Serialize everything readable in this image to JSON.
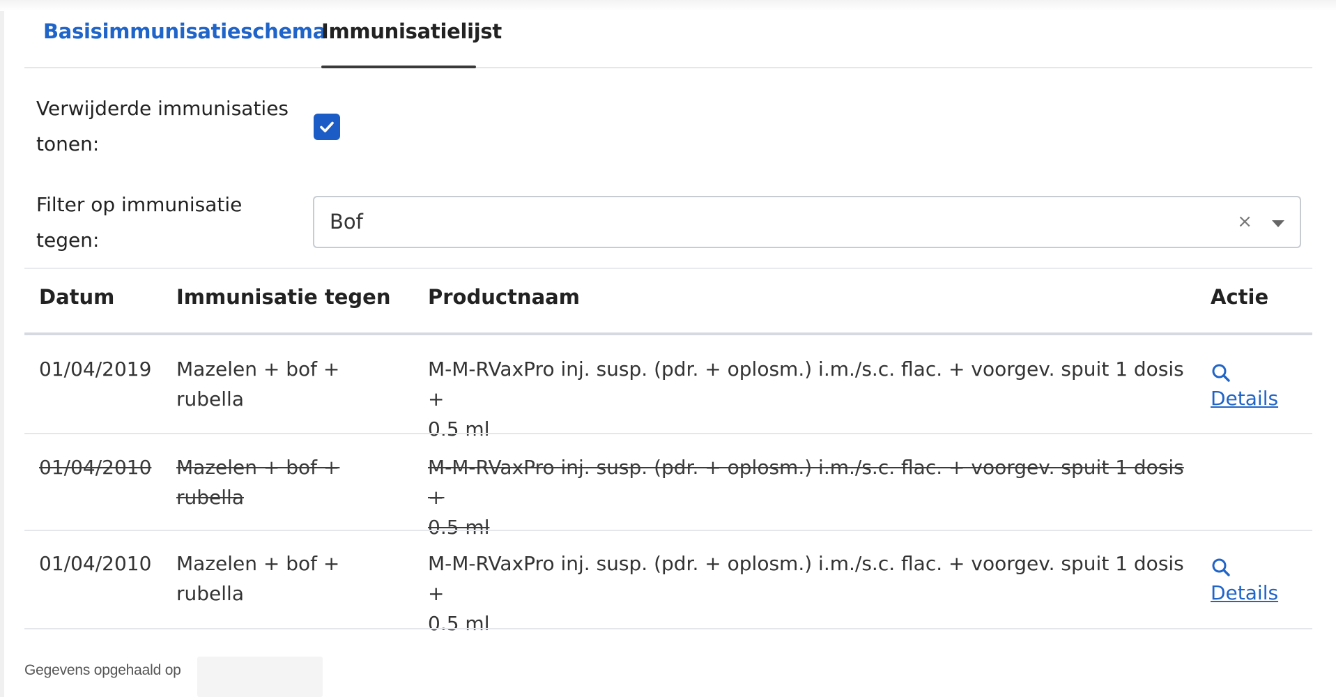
{
  "tabs": [
    {
      "label": "Basisimmunisatieschema",
      "active": false,
      "color": "#1f64c8"
    },
    {
      "label": "Immunisatielijst",
      "active": true
    }
  ],
  "filters": {
    "show_deleted_label_line1": "Verwijderde immunisaties",
    "show_deleted_label_line2": "tonen:",
    "show_deleted_checked": true,
    "filter_label_line1": "Filter op immunisatie",
    "filter_label_line2": "tegen:",
    "filter_value": "Bof",
    "clear_icon": "×",
    "caret_icon": "chevron-down-icon"
  },
  "table": {
    "headers": {
      "date": "Datum",
      "immunisation": "Immunisatie tegen",
      "product": "Productnaam",
      "action": "Actie"
    },
    "rows": [
      {
        "date": "01/04/2019",
        "immunisation_line1": "Mazelen + bof +",
        "immunisation_line2": "rubella",
        "product_line1": "M-M-RVaxPro inj. susp. (pdr. + oplosm.) i.m./s.c. flac. + voorgev. spuit 1 dosis +",
        "product_line2": "0.5 ml",
        "deleted": false,
        "action_label": "Details",
        "action_icon": "search-icon"
      },
      {
        "date": "01/04/2010",
        "immunisation_line1": "Mazelen + bof +",
        "immunisation_line2": "rubella",
        "product_line1": "M-M-RVaxPro inj. susp. (pdr. + oplosm.) i.m./s.c. flac. + voorgev. spuit 1 dosis +",
        "product_line2": "0.5 ml",
        "deleted": true,
        "action_label": ""
      },
      {
        "date": "01/04/2010",
        "immunisation_line1": "Mazelen + bof +",
        "immunisation_line2": "rubella",
        "product_line1": "M-M-RVaxPro inj. susp. (pdr. + oplosm.) i.m./s.c. flac. + voorgev. spuit 1 dosis +",
        "product_line2": "0.5 ml",
        "deleted": false,
        "action_label": "Details",
        "action_icon": "search-icon"
      }
    ]
  },
  "footer": {
    "text": "Gegevens opgehaald op"
  },
  "colors": {
    "accent": "#1f64c8",
    "checkbox": "#1c5cc6"
  }
}
